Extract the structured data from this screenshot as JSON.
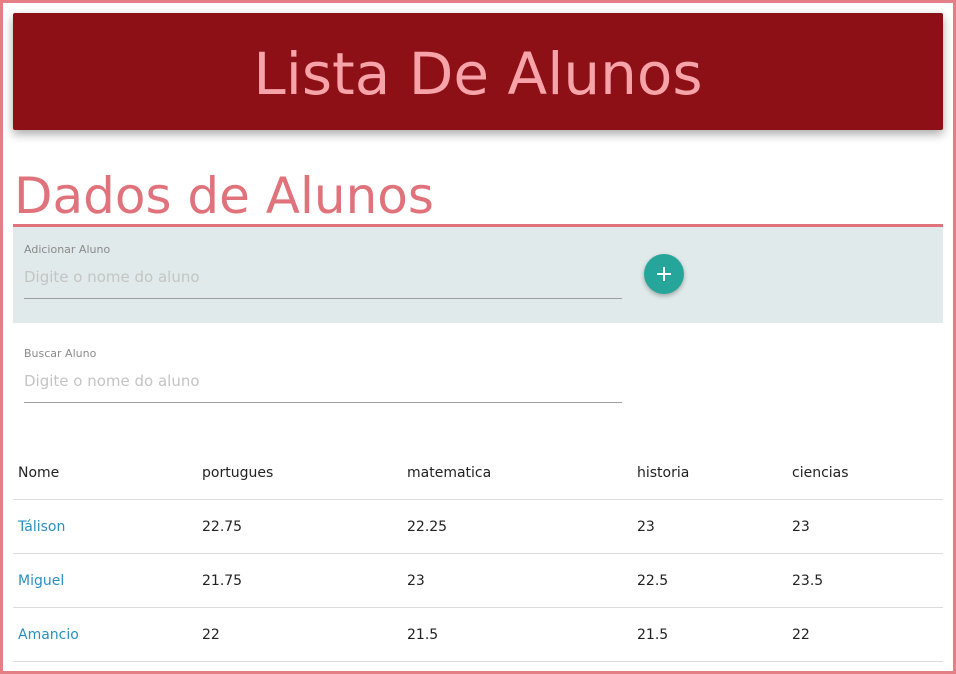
{
  "header": {
    "title": "Lista De Alunos"
  },
  "section": {
    "title": "Dados de Alunos"
  },
  "add_student": {
    "label": "Adicionar Aluno",
    "placeholder": "Digite o nome do aluno",
    "value": "",
    "button_icon": "plus-icon"
  },
  "search_student": {
    "label": "Buscar Aluno",
    "placeholder": "Digite o nome do aluno",
    "value": ""
  },
  "table": {
    "headers": [
      "Nome",
      "portugues",
      "matematica",
      "historia",
      "ciencias"
    ],
    "rows": [
      {
        "nome": "Tálison",
        "portugues": "22.75",
        "matematica": "22.25",
        "historia": "23",
        "ciencias": "23"
      },
      {
        "nome": "Miguel",
        "portugues": "21.75",
        "matematica": "23",
        "historia": "22.5",
        "ciencias": "23.5"
      },
      {
        "nome": "Amancio",
        "portugues": "22",
        "matematica": "21.5",
        "historia": "21.5",
        "ciencias": "22"
      }
    ]
  },
  "colors": {
    "header_bg": "#8c1015",
    "header_text": "#f6a3a9",
    "accent": "#e0727b",
    "panel_bg": "#e0eaea",
    "fab": "#26a69a",
    "link": "#2a8fbf"
  }
}
